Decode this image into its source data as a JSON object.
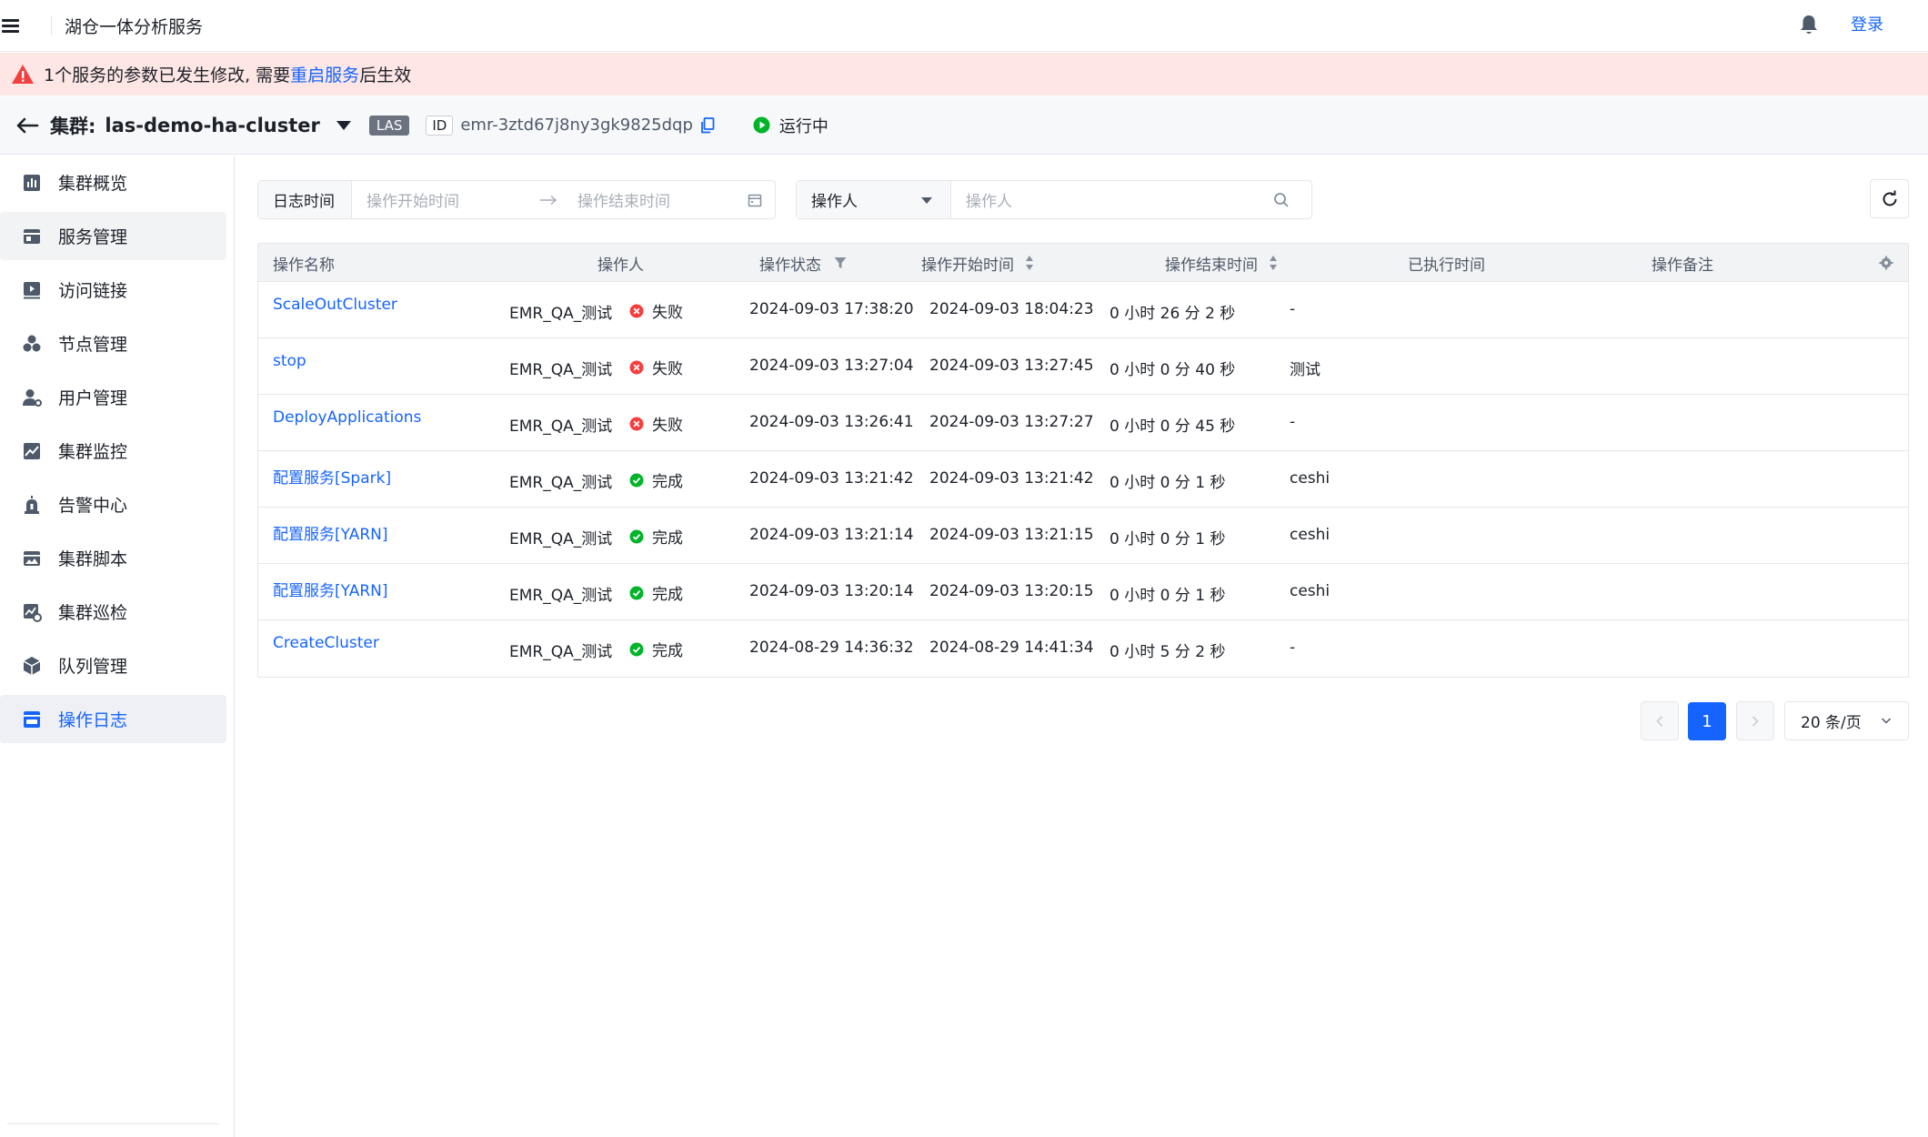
{
  "app": {
    "title": "湖仓一体分析服务",
    "login": "登录"
  },
  "alert": {
    "prefix": "1个服务的参数已发生修改, 需要",
    "link": "重启服务",
    "suffix": "后生效"
  },
  "cluster": {
    "label": "集群:",
    "name": "las-demo-ha-cluster",
    "type_badge": "LAS",
    "id_label": "ID",
    "id_value": "emr-3ztd67j8ny3gk9825dqp",
    "status": "运行中"
  },
  "sidebar": {
    "items": [
      {
        "label": "集群概览",
        "icon": "bar-chart-icon"
      },
      {
        "label": "服务管理",
        "icon": "service-icon"
      },
      {
        "label": "访问链接",
        "icon": "play-link-icon"
      },
      {
        "label": "节点管理",
        "icon": "nodes-icon"
      },
      {
        "label": "用户管理",
        "icon": "user-gear-icon"
      },
      {
        "label": "集群监控",
        "icon": "monitor-chart-icon"
      },
      {
        "label": "告警中心",
        "icon": "alarm-icon"
      },
      {
        "label": "集群脚本",
        "icon": "script-icon"
      },
      {
        "label": "集群巡检",
        "icon": "inspection-icon"
      },
      {
        "label": "队列管理",
        "icon": "cube-icon"
      },
      {
        "label": "操作日志",
        "icon": "log-icon"
      }
    ],
    "active_index": 10,
    "hover_index": 1
  },
  "filters": {
    "date_label": "日志时间",
    "start_placeholder": "操作开始时间",
    "end_placeholder": "操作结束时间",
    "user_select": "操作人",
    "user_placeholder": "操作人"
  },
  "table": {
    "columns": [
      "操作名称",
      "操作人",
      "操作状态",
      "操作开始时间",
      "操作结束时间",
      "已执行时间",
      "操作备注"
    ],
    "rows": [
      {
        "name": "ScaleOutCluster",
        "operator": "EMR_QA_测试",
        "status": "失败",
        "status_type": "fail",
        "start": "2024-09-03 17:38:20",
        "end": "2024-09-03 18:04:23",
        "duration": "0 小时 26 分 2 秒",
        "note": "-"
      },
      {
        "name": "stop",
        "operator": "EMR_QA_测试",
        "status": "失败",
        "status_type": "fail",
        "start": "2024-09-03 13:27:04",
        "end": "2024-09-03 13:27:45",
        "duration": "0 小时 0 分 40 秒",
        "note": "测试"
      },
      {
        "name": "DeployApplications",
        "operator": "EMR_QA_测试",
        "status": "失败",
        "status_type": "fail",
        "start": "2024-09-03 13:26:41",
        "end": "2024-09-03 13:27:27",
        "duration": "0 小时 0 分 45 秒",
        "note": "-"
      },
      {
        "name": "配置服务[Spark]",
        "operator": "EMR_QA_测试",
        "status": "完成",
        "status_type": "success",
        "start": "2024-09-03 13:21:42",
        "end": "2024-09-03 13:21:42",
        "duration": "0 小时 0 分 1 秒",
        "note": "ceshi"
      },
      {
        "name": "配置服务[YARN]",
        "operator": "EMR_QA_测试",
        "status": "完成",
        "status_type": "success",
        "start": "2024-09-03 13:21:14",
        "end": "2024-09-03 13:21:15",
        "duration": "0 小时 0 分 1 秒",
        "note": "ceshi"
      },
      {
        "name": "配置服务[YARN]",
        "operator": "EMR_QA_测试",
        "status": "完成",
        "status_type": "success",
        "start": "2024-09-03 13:20:14",
        "end": "2024-09-03 13:20:15",
        "duration": "0 小时 0 分 1 秒",
        "note": "ceshi"
      },
      {
        "name": "CreateCluster",
        "operator": "EMR_QA_测试",
        "status": "完成",
        "status_type": "success",
        "start": "2024-08-29 14:36:32",
        "end": "2024-08-29 14:41:34",
        "duration": "0 小时 5 分 2 秒",
        "note": "-"
      }
    ]
  },
  "pagination": {
    "current_page": "1",
    "page_size": "20 条/页"
  },
  "colors": {
    "accent": "#1664ff",
    "fail": "#f53f3f",
    "success": "#00b42a",
    "alert_bg": "#fde6e4"
  }
}
